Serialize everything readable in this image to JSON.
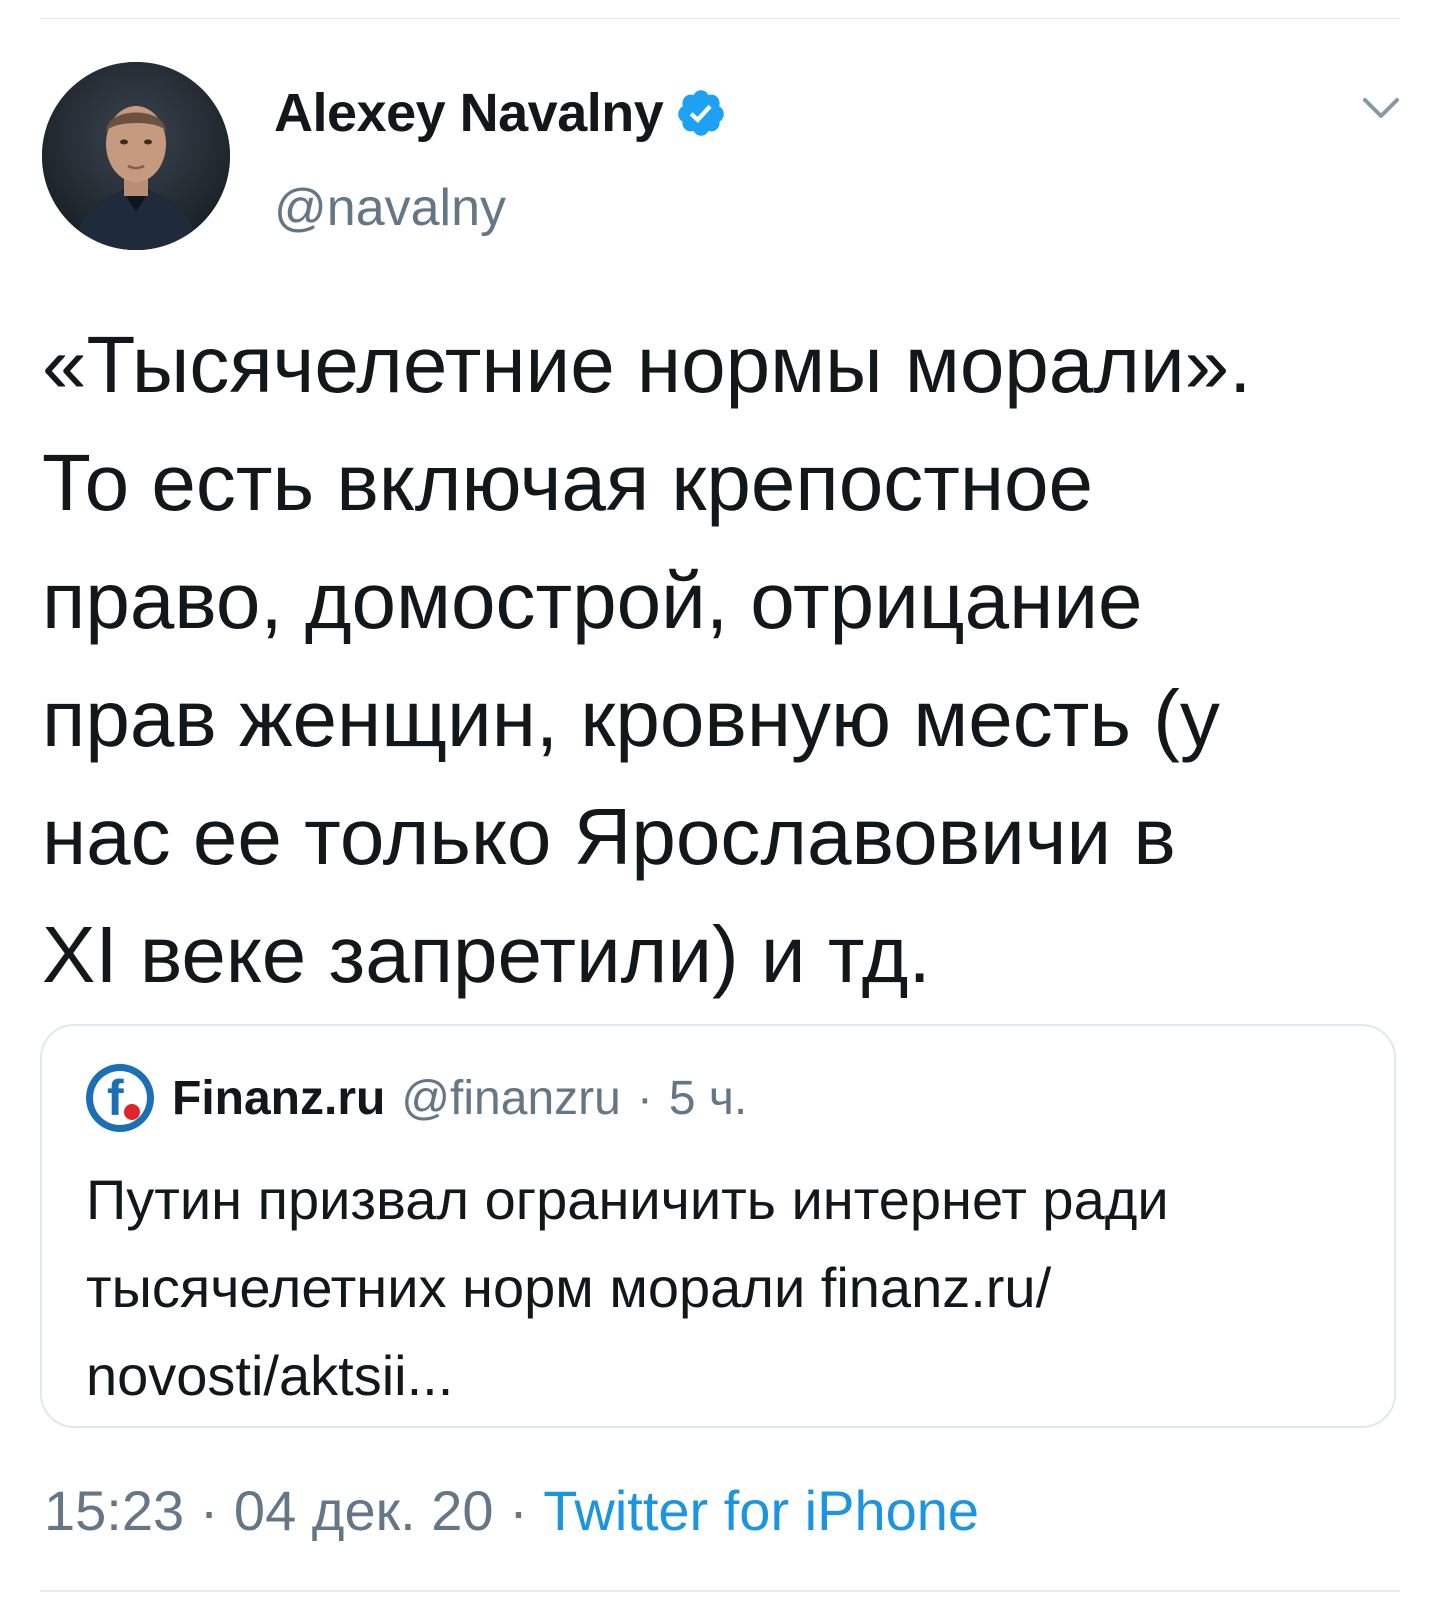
{
  "tweet": {
    "author": {
      "name": "Alexey Navalny",
      "handle": "@navalny",
      "verified": true
    },
    "text": "«Тысячелетние нормы морали».\nТо есть включая крепостное\nправо, домострой, отрицание\nправ женщин, кровную месть (у\nнас ее только Ярославовичи в\nXI веке запретили) и тд.",
    "quoted": {
      "name": "Finanz.ru",
      "handle": "@finanzru",
      "separator": "·",
      "time": "5 ч.",
      "text": "Путин призвал ограничить интернет ради\nтысячелетних норм морали  finanz.ru/\nnovosti/aktsii..."
    },
    "meta": {
      "time": "15:23",
      "separator": "·",
      "date": "04 дек. 20",
      "source": "Twitter for iPhone"
    }
  },
  "colors": {
    "text": "#14171a",
    "secondary": "#657786",
    "link": "#1b95e0",
    "verified": "#1da1f2",
    "border": "#e1e8ed"
  },
  "icons": [
    "verified-badge-icon",
    "caret-down-icon",
    "finanz-logo-icon"
  ]
}
